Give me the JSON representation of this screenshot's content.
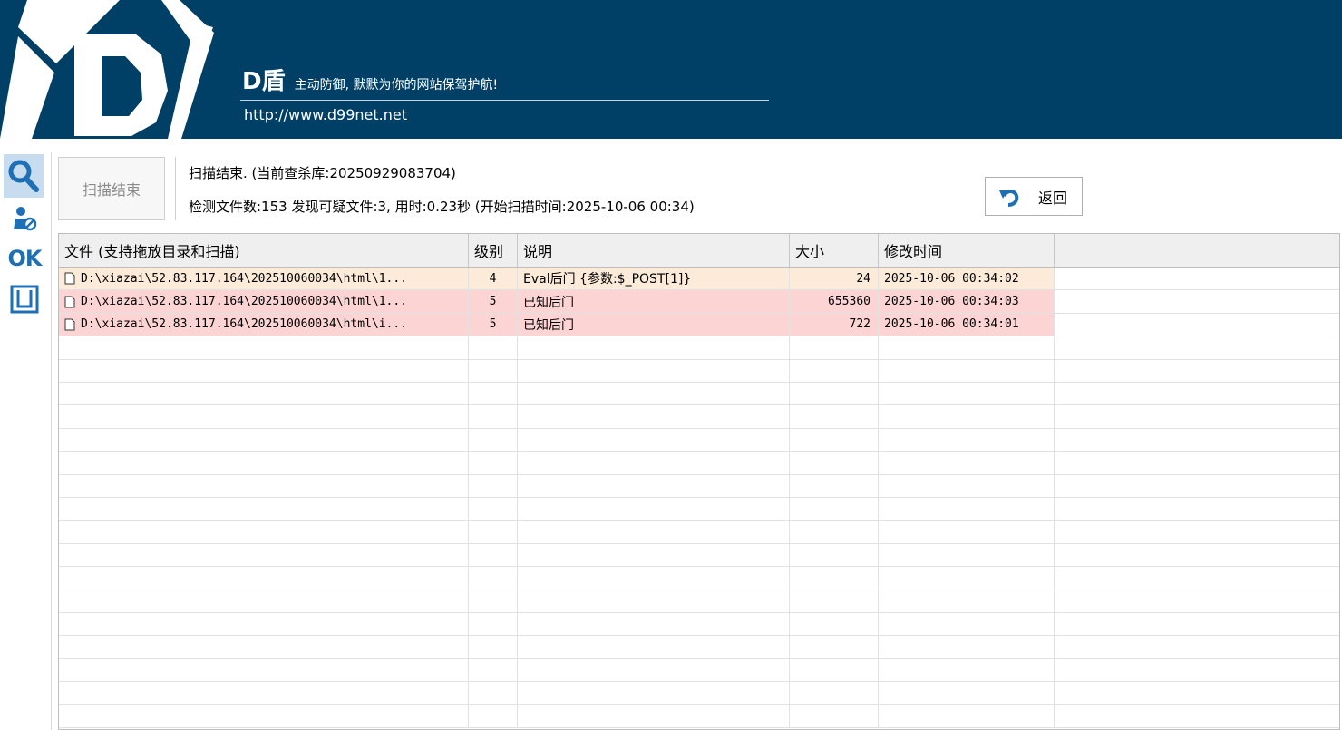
{
  "banner": {
    "brand_name": "D盾",
    "slogan": "主动防御, 默默为你的网站保驾护航!",
    "url": "http://www.d99net.net",
    "colors": {
      "background": "#003f66",
      "text": "#ffffff"
    }
  },
  "sidebar": {
    "items": [
      {
        "icon": "search-icon",
        "active": true
      },
      {
        "icon": "user-lock-icon",
        "active": false
      },
      {
        "icon": "ok-icon",
        "label": "OK",
        "active": false
      },
      {
        "icon": "window-frame-icon",
        "active": false
      }
    ]
  },
  "scan": {
    "button_label": "扫描结束",
    "status_line1": "扫描结束. (当前查杀库:20250929083704)",
    "status_line2": "检测文件数:153 发现可疑文件:3, 用时:0.23秒 (开始扫描时间:2025-10-06 00:34)",
    "back_button_label": "返回",
    "back_icon": "undo-arrow-icon"
  },
  "table": {
    "columns": [
      "文件 (支持拖放目录和扫描)",
      "级别",
      "说明",
      "大小",
      "修改时间"
    ],
    "rows": [
      {
        "file": "D:\\xiazai\\52.83.117.164\\202510060034\\html\\1...",
        "level": "4",
        "desc": "Eval后门 {参数:$_POST[1]}",
        "size": "24",
        "mtime": "2025-10-06 00:34:02"
      },
      {
        "file": "D:\\xiazai\\52.83.117.164\\202510060034\\html\\1...",
        "level": "5",
        "desc": "已知后门",
        "size": "655360",
        "mtime": "2025-10-06 00:34:03"
      },
      {
        "file": "D:\\xiazai\\52.83.117.164\\202510060034\\html\\i...",
        "level": "5",
        "desc": "已知后门",
        "size": "722",
        "mtime": "2025-10-06 00:34:01"
      }
    ],
    "colors": {
      "level4": "#fcebd9",
      "level5": "#fcd4d4"
    }
  }
}
